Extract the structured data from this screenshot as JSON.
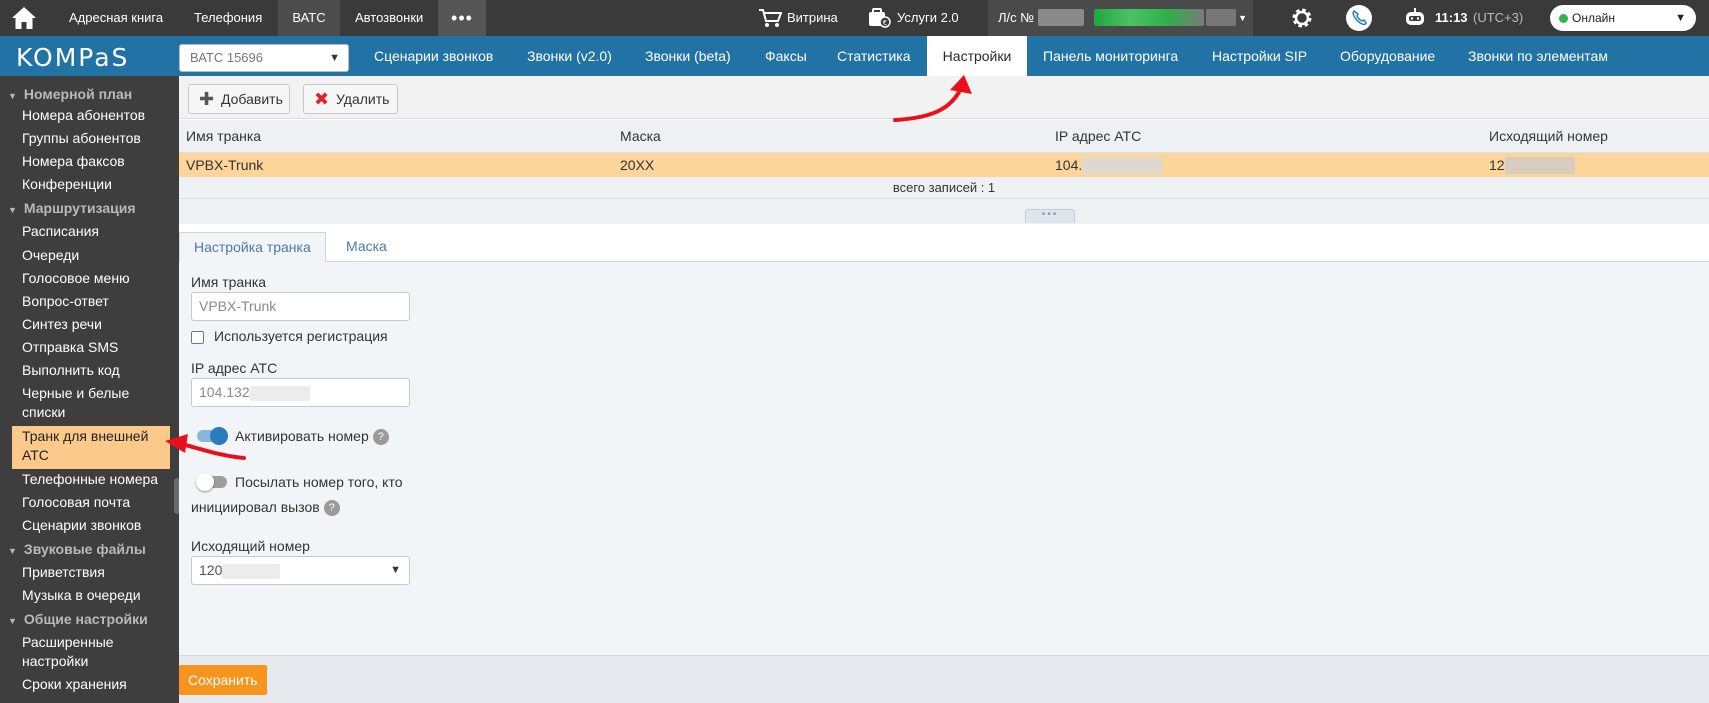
{
  "topbar": {
    "nav": [
      "Адресная книга",
      "Телефония",
      "ВАТС",
      "Автозвонки"
    ],
    "more": "•••",
    "showcase": "Витрина",
    "services": "Услуги 2.0",
    "account_label": "Л/с №",
    "time": "11:13",
    "timezone": "(UTC+3)",
    "status": "Онлайн"
  },
  "brand": {
    "logo": "KOMPaS"
  },
  "atc_select": {
    "value": "ВАТС 15696"
  },
  "tabs": [
    "Сценарии звонков",
    "Звонки (v2.0)",
    "Звонки (beta)",
    "Факсы",
    "Статистика",
    "Настройки",
    "Панель мониторинга",
    "Настройки SIP",
    "Оборудование",
    "Звонки по элементам"
  ],
  "active_tab": "Настройки",
  "sidebar": {
    "sec1": "Номерной план",
    "items1": [
      "Номера абонентов",
      "Группы абонентов",
      "Номера факсов",
      "Конференции"
    ],
    "sec2": "Маршрутизация",
    "items2": [
      "Расписания",
      "Очереди",
      "Голосовое меню",
      "Вопрос-ответ",
      "Синтез речи",
      "Отправка SMS",
      "Выполнить код"
    ],
    "item_bw": "Черные и белые списки",
    "item_active": "Транк для внешней АТС",
    "items3": [
      "Телефонные номера",
      "Голосовая почта",
      "Сценарии звонков"
    ],
    "sec3": "Звуковые файлы",
    "items4": [
      "Приветствия",
      "Музыка в очереди"
    ],
    "sec4": "Общие настройки",
    "item_ext": "Расширенные настройки",
    "item_retention": "Сроки хранения"
  },
  "toolbar": {
    "add": "Добавить",
    "delete": "Удалить"
  },
  "grid": {
    "columns": [
      "Имя транка",
      "Маска",
      "IP адрес АТС",
      "Исходящий номер"
    ],
    "row": {
      "name": "VPBX-Trunk",
      "mask": "20XX",
      "ip": "104.",
      "outgoing": "12"
    },
    "total": "всего записей : 1"
  },
  "subtabs": [
    "Настройка транка",
    "Маска"
  ],
  "form": {
    "trunk_name_label": "Имя транка",
    "trunk_name_value": "VPBX-Trunk",
    "registration_label": "Используется регистрация",
    "registration_checked": false,
    "ip_label": "IP адрес АТС",
    "ip_value": "104.132",
    "activate_label": "Активировать номер",
    "activate_on": true,
    "send_caller_label1": "Посылать номер того, кто",
    "send_caller_label2": "инициировал вызов",
    "send_caller_on": false,
    "outgoing_label": "Исходящий номер",
    "outgoing_value": "120",
    "help": "?"
  },
  "save": "Сохранить",
  "colors": {
    "topbar": "#3a3a3a",
    "navbar": "#2173a6",
    "sidebar": "#3e3e3e",
    "highlight": "#fbd59a",
    "save": "#f7941d",
    "toggle_on": "#2b7bbf",
    "arrow": "#e8101a"
  }
}
